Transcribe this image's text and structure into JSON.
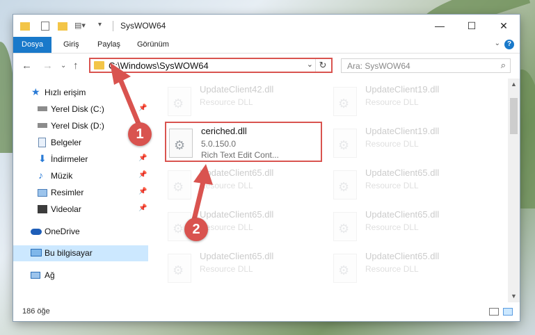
{
  "window": {
    "title": "SysWOW64",
    "controls": {
      "minimize": "—",
      "maximize": "☐",
      "close": "✕"
    }
  },
  "ribbon": {
    "tabs": [
      "Dosya",
      "Giriş",
      "Paylaş",
      "Görünüm"
    ]
  },
  "address": {
    "path": "C:\\Windows\\SysWOW64",
    "search_placeholder": "Ara: SysWOW64"
  },
  "sidebar": {
    "items": [
      {
        "label": "Hızlı erişim",
        "icon": "star-icon"
      },
      {
        "label": "Yerel Disk (C:)",
        "icon": "drive-icon",
        "pinned": true
      },
      {
        "label": "Yerel Disk (D:)",
        "icon": "drive-icon"
      },
      {
        "label": "Belgeler",
        "icon": "document-icon",
        "pinned": true
      },
      {
        "label": "İndirmeler",
        "icon": "download-icon",
        "pinned": true
      },
      {
        "label": "Müzik",
        "icon": "music-icon",
        "pinned": true
      },
      {
        "label": "Resimler",
        "icon": "pictures-icon",
        "pinned": true
      },
      {
        "label": "Videolar",
        "icon": "video-icon",
        "pinned": true
      },
      {
        "label": "OneDrive",
        "icon": "cloud-icon"
      },
      {
        "label": "Bu bilgisayar",
        "icon": "computer-icon",
        "selected": true
      },
      {
        "label": "Ağ",
        "icon": "network-icon"
      }
    ]
  },
  "files": {
    "left": [
      {
        "name": "UpdateClient42.dll",
        "desc": "Resource DLL"
      },
      {
        "name": "ceriched.dll",
        "desc": "5.0.150.0",
        "desc2": "Rich Text Edit Cont...",
        "highlighted": true
      },
      {
        "name": "UpdateClient65.dll",
        "desc": "Resource DLL"
      },
      {
        "name": "UpdateClient65.dll",
        "desc": "Resource DLL"
      },
      {
        "name": "UpdateClient65.dll",
        "desc": "Resource DLL"
      }
    ],
    "right": [
      {
        "name": "UpdateClient19.dll",
        "desc": "Resource DLL"
      },
      {
        "name": "UpdateClient19.dll",
        "desc": "Resource DLL"
      },
      {
        "name": "UpdateClient65.dll",
        "desc": "Resource DLL"
      },
      {
        "name": "UpdateClient65.dll",
        "desc": "Resource DLL"
      },
      {
        "name": "UpdateClient65.dll",
        "desc": "Resource DLL"
      }
    ]
  },
  "status": {
    "count": "186 öğe"
  },
  "annotations": {
    "badge1": "1",
    "badge2": "2",
    "color": "#d9534f"
  }
}
